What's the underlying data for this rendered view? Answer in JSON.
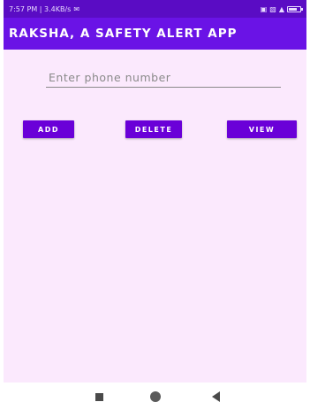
{
  "status_bar": {
    "left_text": "7:57 PM | 3.4KB/s",
    "mail_icon": "mail-icon",
    "right_icons": [
      "hd-icon",
      "signal-4g-icon",
      "signal-icon",
      "battery-icon"
    ]
  },
  "app_bar": {
    "title": "RAKSHA, A SAFETY ALERT APP"
  },
  "form": {
    "phone_placeholder": "Enter phone number"
  },
  "buttons": {
    "add_label": "ADD",
    "delete_label": "DELETE",
    "view_label": "VIEW"
  },
  "colors": {
    "status_bar": "#5a0cc4",
    "app_bar": "#6a13e6",
    "button": "#6a00d8",
    "background": "#fbe9fd"
  }
}
